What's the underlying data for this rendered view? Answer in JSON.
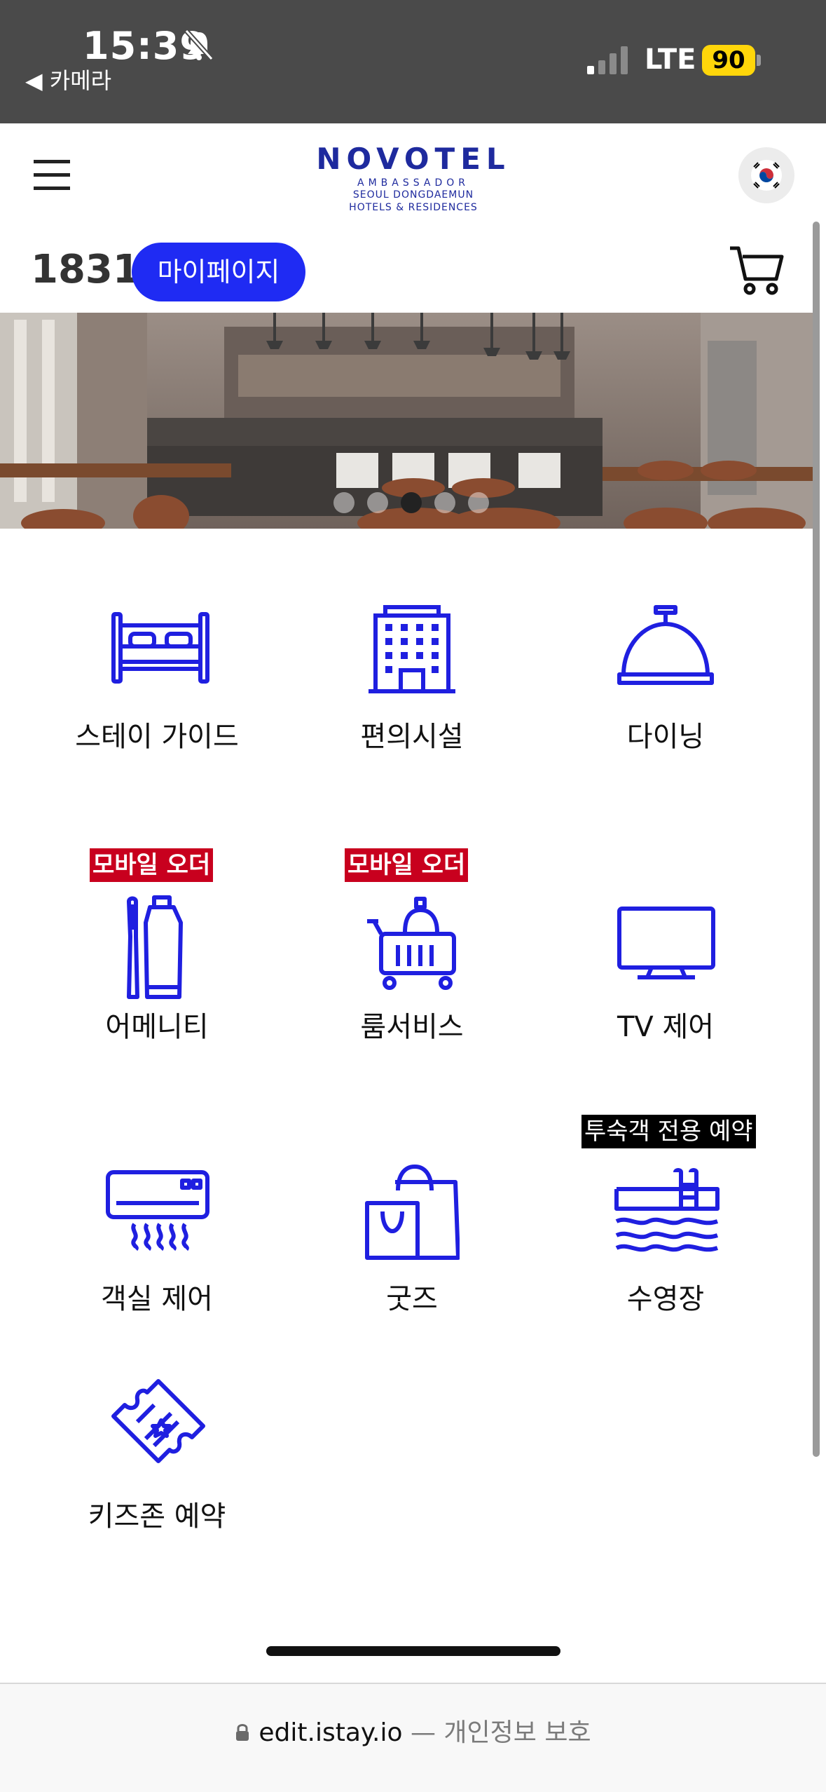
{
  "status_bar": {
    "time": "15:39",
    "back_label": "◀ 카메라",
    "network": "LTE",
    "battery": "90"
  },
  "header": {
    "logo": {
      "brand": "NOVOTEL",
      "line1": "AMBASSADOR",
      "line2": "SEOUL DONGDAEMUN",
      "line3": "HOTELS & RESIDENCES"
    },
    "language_icon": "korea-flag-icon"
  },
  "room": {
    "number": "1831",
    "mypage_label": "마이페이지"
  },
  "banner": {
    "slide_count": 5,
    "active_slide": 3
  },
  "menu": {
    "stay_guide": "스테이 가이드",
    "facilities": "편의시설",
    "dining": "다이닝",
    "amenities": "어메니티",
    "amenities_badge": "모바일 오더",
    "room_service": "룸서비스",
    "room_service_badge": "모바일 오더",
    "tv_control": "TV 제어",
    "room_control": "객실 제어",
    "goods": "굿즈",
    "pool": "수영장",
    "pool_badge": "투숙객 전용 예약",
    "kids_zone": "키즈존 예약"
  },
  "browser": {
    "url": "edit.istay.io",
    "url_suffix": " — 개인정보 보호"
  },
  "colors": {
    "accent": "#1f2bf3",
    "icon": "#1f1fe0",
    "badge_red": "#c8001e",
    "logo": "#1e2a9e"
  }
}
